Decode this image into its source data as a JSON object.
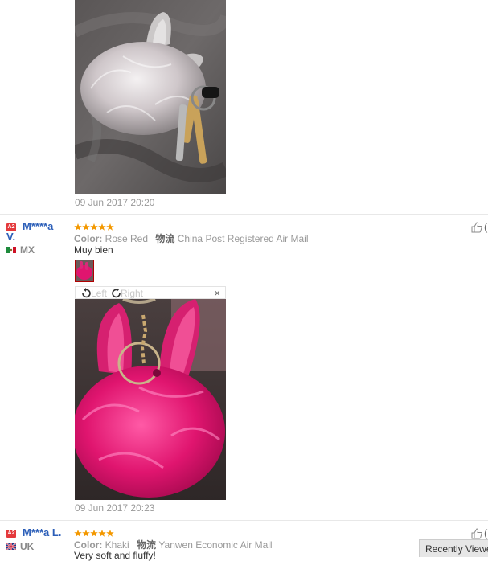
{
  "review_prev": {
    "date": "09 Jun 2017 20:20"
  },
  "review_1": {
    "badge": "A2",
    "name_line1": "M****a",
    "name_line2": "V.",
    "country": "MX",
    "color_label": "Color:",
    "color_value": "Rose Red",
    "shipping_cn": "物流",
    "shipping_value": "China Post Registered Air Mail",
    "text": "Muy bien",
    "viewer_left": "Left",
    "viewer_right": "Right",
    "viewer_close": "×",
    "date": "09 Jun 2017 20:23",
    "rating": 5
  },
  "review_2": {
    "badge": "A2",
    "name": "M***a L.",
    "country": "UK",
    "color_label": "Color:",
    "color_value": "Khaki",
    "shipping_cn": "物流",
    "shipping_value": "Yanwen Economic Air Mail",
    "text": "Very soft and fluffy!",
    "rating": 5
  },
  "recently_viewed": "Recently Viewed",
  "colors": {
    "name_blue": "#2b5eb8",
    "star_orange": "#f39800",
    "rose": "#e0156f"
  }
}
